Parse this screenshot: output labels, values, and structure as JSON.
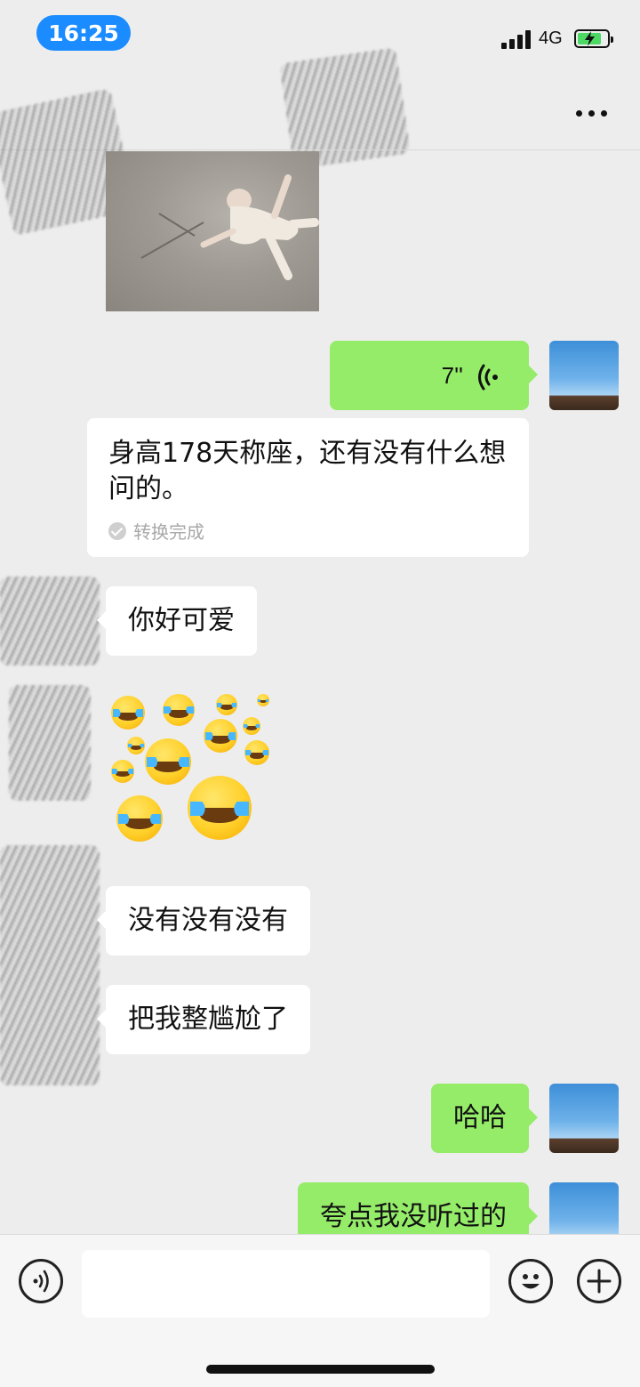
{
  "status_bar": {
    "time": "16:25",
    "network": "4G"
  },
  "nav": {
    "more_icon": "more-dots-icon"
  },
  "messages": {
    "voice": {
      "duration": "7''"
    },
    "transcript": {
      "text": "身高178天称座，还有没有什么想问的。",
      "status": "转换完成"
    },
    "m1": "你好可爱",
    "m2": "没有没有没有",
    "m3": "把我整尴尬了",
    "m4": "哈哈",
    "m5": "夸点我没听过的"
  },
  "input_bar": {
    "voice_icon": "voice-input-icon",
    "emoji_icon": "emoji-icon",
    "plus_icon": "plus-icon",
    "placeholder": ""
  },
  "colors": {
    "bg": "#ededed",
    "sent_bubble": "#95ec69",
    "received_bubble": "#ffffff",
    "time_pill": "#1a8cff"
  }
}
